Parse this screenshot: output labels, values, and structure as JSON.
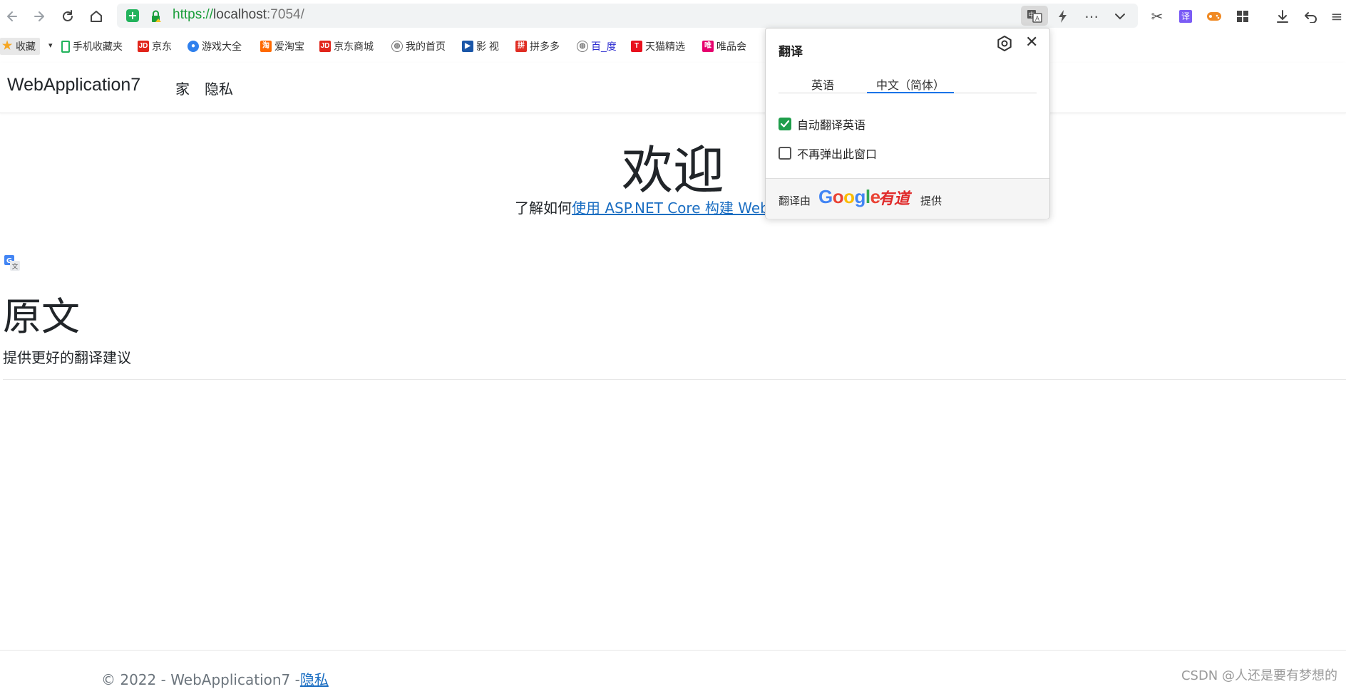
{
  "browser": {
    "url_protocol": "https://",
    "url_host": "localhost",
    "url_port_path": ":7054/",
    "bookmarks": [
      {
        "label": "收藏",
        "icon": "star-icon",
        "color": "#f5a623"
      },
      {
        "label": "手机收藏夹",
        "icon": "phone-icon",
        "color": "#22b35c"
      },
      {
        "label": "京东",
        "icon": "jd-icon",
        "color": "#e1251b"
      },
      {
        "label": "游戏大全",
        "icon": "game-icon",
        "color": "#2f80ed"
      },
      {
        "label": "爱淘宝",
        "icon": "taobao-icon",
        "color": "#ff6a00"
      },
      {
        "label": "京东商城",
        "icon": "jd-icon",
        "color": "#e1251b"
      },
      {
        "label": "我的首页",
        "icon": "globe-icon",
        "color": "#777777"
      },
      {
        "label": "影 视",
        "icon": "video-icon",
        "color": "#1a56a8"
      },
      {
        "label": "拼多多",
        "icon": "pdd-icon",
        "color": "#e02e24"
      },
      {
        "label": "百_度",
        "icon": "globe-icon",
        "color": "#777777"
      },
      {
        "label": "天猫精选",
        "icon": "tmall-icon",
        "color": "#e8101d"
      },
      {
        "label": "唯品会",
        "icon": "vip-icon",
        "color": "#e6006e"
      }
    ]
  },
  "site": {
    "brand": "WebApplication7",
    "nav": [
      "家",
      "隐私"
    ],
    "welcome": "欢迎",
    "learn_prefix": "了解如何",
    "learn_link": "使用 ASP.NET Core 构建 Web",
    "original_title": "原文",
    "original_sub": "提供更好的翻译建议",
    "footer_text": "© 2022 - WebApplication7 -",
    "footer_link": "隐私",
    "watermark": "CSDN @人还是要有梦想的"
  },
  "translate_popup": {
    "title": "翻译",
    "tabs": [
      "英语",
      "中文（简体）"
    ],
    "active_tab": 1,
    "options": [
      {
        "label": "自动翻译英语",
        "checked": true
      },
      {
        "label": "不再弹出此窗口",
        "checked": false
      }
    ],
    "footer_prefix": "翻译由",
    "footer_suffix": "提供",
    "provider_google": "Google",
    "provider_youdao": "有道"
  },
  "colors": {
    "link": "#1b6ec2",
    "check_on": "#1f9e4b",
    "tab_active": "#1a73e8"
  }
}
